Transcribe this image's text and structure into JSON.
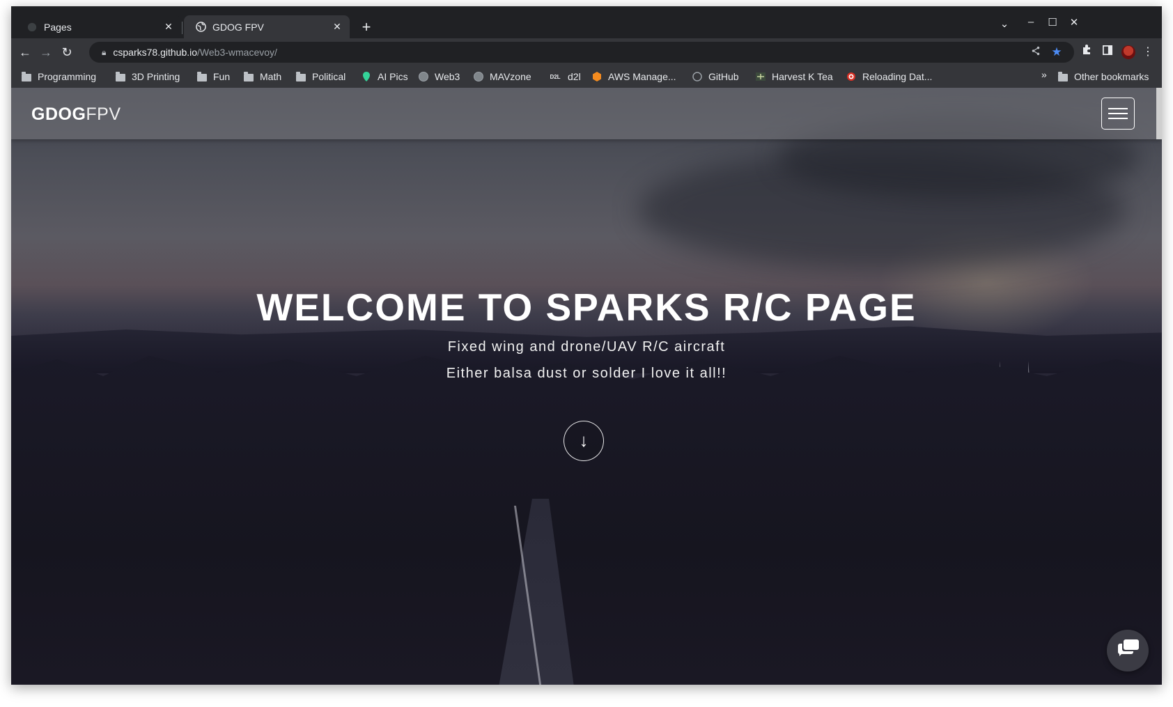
{
  "browser": {
    "tabs": [
      {
        "title": "Pages",
        "active": false
      },
      {
        "title": "GDOG FPV",
        "active": true
      }
    ],
    "url": {
      "host": "csparks78.github.io",
      "path": "/Web3-wmacevoy/"
    },
    "bookmarks": [
      {
        "label": "Programming",
        "icon": "folder-icon"
      },
      {
        "label": "3D Printing",
        "icon": "folder-icon"
      },
      {
        "label": "Fun",
        "icon": "folder-icon"
      },
      {
        "label": "Math",
        "icon": "folder-icon"
      },
      {
        "label": "Political",
        "icon": "folder-icon"
      },
      {
        "label": "AI Pics",
        "icon": "pin-icon"
      },
      {
        "label": "Web3",
        "icon": "globe-icon"
      },
      {
        "label": "MAVzone",
        "icon": "globe-icon"
      },
      {
        "label": "d2l",
        "icon": "d2l-icon",
        "icon_text": "D2L"
      },
      {
        "label": "AWS Manage...",
        "icon": "aws-icon"
      },
      {
        "label": "GitHub",
        "icon": "github-icon"
      },
      {
        "label": "Harvest K Tea",
        "icon": "tea-icon"
      },
      {
        "label": "Reloading Dat...",
        "icon": "target-icon"
      }
    ],
    "other_bookmarks": "Other bookmarks",
    "overflow_glyph": "»"
  },
  "site": {
    "brand_bold": "GDOG",
    "brand_light": "FPV",
    "hero_title": "WELCOME TO SPARKS R/C PAGE",
    "hero_line1": "Fixed wing and drone/UAV R/C aircraft",
    "hero_line2": "Either balsa dust or solder I love it all!!"
  },
  "colors": {
    "chrome_dark": "#202124",
    "chrome_toolbar": "#35363a",
    "bookmark_star": "#4c8bf5"
  }
}
